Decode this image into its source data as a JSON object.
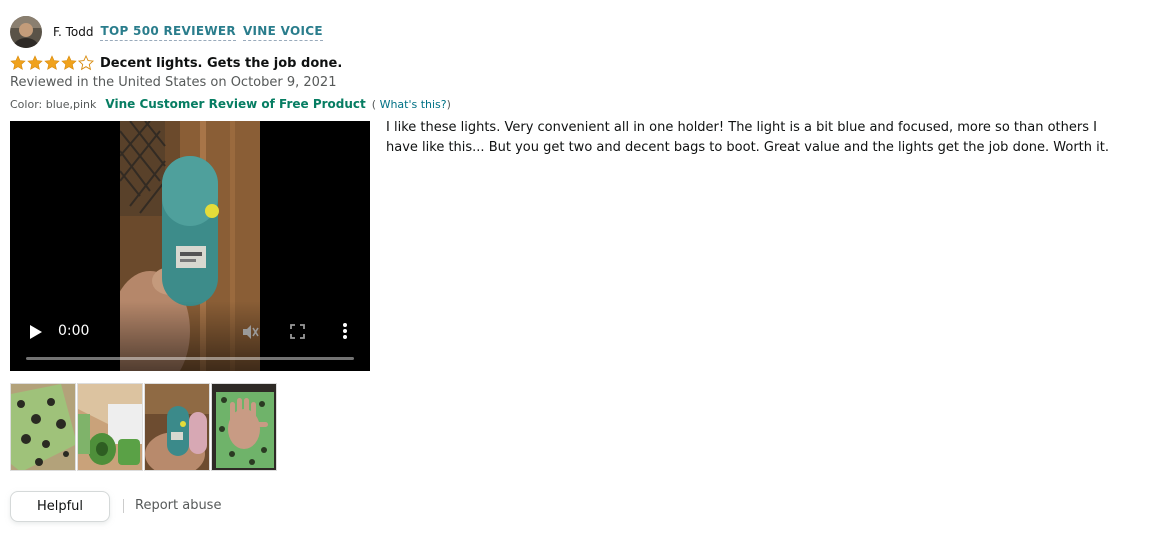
{
  "reviewer": {
    "name": "F. Todd",
    "badges": [
      "TOP 500 REVIEWER",
      "VINE VOICE"
    ]
  },
  "review": {
    "rating": 4,
    "rating_max": 5,
    "title": "Decent lights. Gets the job done.",
    "date": "Reviewed in the United States on October 9, 2021",
    "color": "Color: blue,pink",
    "vine_label": "Vine Customer Review of Free Product",
    "whats_this_open": "(",
    "whats_this": "What's this?",
    "whats_this_close": ")",
    "body": "I like these lights. Very convenient all in one holder! The light is a bit blue and focused, more so than others I have like this... But you get two and decent bags to boot. Great value and the lights get the job done. Worth it."
  },
  "video": {
    "time": "0:00",
    "progress": 0
  },
  "actions": {
    "helpful": "Helpful",
    "report": "Report abuse"
  },
  "colors": {
    "star": "#f0a21c",
    "badge": "#2a7d8c",
    "vine": "#067d62",
    "link": "#007185",
    "muted": "#565959"
  }
}
